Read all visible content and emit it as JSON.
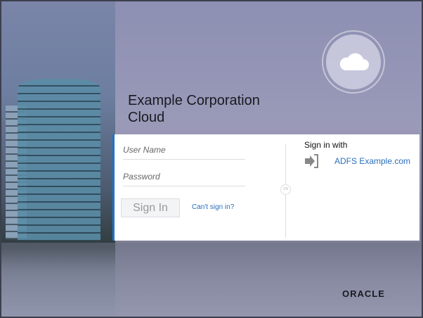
{
  "brand": {
    "title_line1": "Example Corporation",
    "title_line2": "Cloud",
    "logo": "ORACLE"
  },
  "login": {
    "username_placeholder": "User Name",
    "username_value": "",
    "password_placeholder": "Password",
    "password_value": "",
    "sign_in_label": "Sign In",
    "cant_sign_in_label": "Can't sign in?",
    "or_label": "OR"
  },
  "sso": {
    "heading": "Sign in with",
    "provider_label": "ADFS Example.com",
    "icon": "sign-in-arrow-icon"
  },
  "colors": {
    "accent": "#1e73c8",
    "link": "#2a6ebb"
  }
}
